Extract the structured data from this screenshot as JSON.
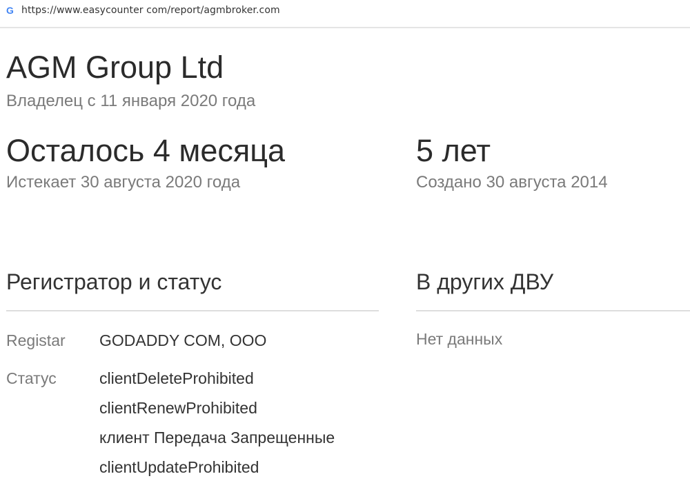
{
  "browser": {
    "url": "https://www.easycounter com/report/agmbroker.com",
    "favicon": "google-g-icon"
  },
  "header": {
    "title": "AGM Group Ltd",
    "owner_since": "Владелец с 11 января 2020 года"
  },
  "expiry": {
    "remaining": "Осталось 4 месяца",
    "expires": "Истекает 30 августа 2020 года"
  },
  "age": {
    "years": "5 лет",
    "created": "Создано 30 августа 2014"
  },
  "registrar_section": {
    "heading": "Регистратор и статус",
    "registrar_label": "Registar",
    "registrar_value": "GODADDY COM, OOO",
    "status_label": "Статус",
    "statuses": [
      "clientDeleteProhibited",
      "clientRenewProhibited",
      "клиент Передача Запрещенные",
      "clientUpdateProhibited"
    ]
  },
  "other_zones": {
    "heading": "В других ДВУ",
    "value": "Нет данных"
  }
}
